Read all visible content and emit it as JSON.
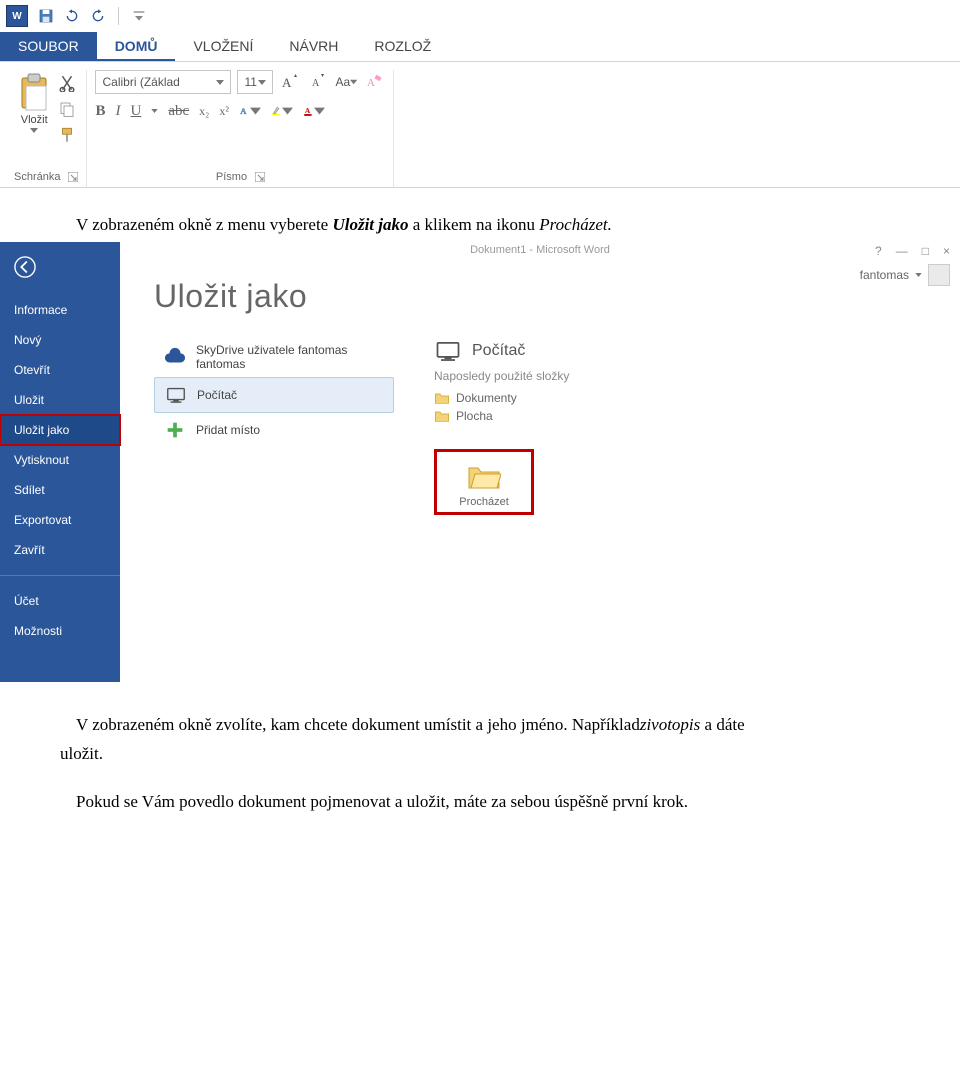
{
  "qat": {
    "app_abbrev": "W"
  },
  "tabs": {
    "file": "SOUBOR",
    "home": "DOMŮ",
    "insert": "VLOŽENÍ",
    "design": "NÁVRH",
    "layout": "ROZLOŽ"
  },
  "ribbon": {
    "clipboard": {
      "paste": "Vložit",
      "group_label": "Schránka"
    },
    "font": {
      "family": "Calibri (Základ",
      "size": "11",
      "group_label": "Písmo",
      "aa": "Aa",
      "bold": "B",
      "italic": "I",
      "underline": "U",
      "strike": "abc",
      "sub": "x₂",
      "sup": "x²"
    }
  },
  "para1": {
    "pre": "V zobrazeném okně z menu vyberete ",
    "em": "Uložit jako",
    "mid": " a klikem na ikonu ",
    "em2": "Procházet.",
    "post": ""
  },
  "backstage": {
    "titlebar": "Dokument1 - Microsoft Word",
    "user": "fantomas",
    "side": {
      "info": "Informace",
      "new": "Nový",
      "open": "Otevřít",
      "save": "Uložit",
      "saveas": "Uložit jako",
      "print": "Vytisknout",
      "share": "Sdílet",
      "export": "Exportovat",
      "close": "Zavřít",
      "account": "Účet",
      "options": "Možnosti"
    },
    "heading": "Uložit jako",
    "locations": {
      "skydrive_l1": "SkyDrive uživatele fantomas",
      "skydrive_l2": "fantomas",
      "computer": "Počítač",
      "add_place": "Přidat místo"
    },
    "right": {
      "computer": "Počítač",
      "recent_heading": "Naposledy použité složky",
      "documents": "Dokumenty",
      "desktop": "Plocha",
      "browse": "Procházet"
    }
  },
  "para2": {
    "pre": "V zobrazeném okně zvolíte, kam chcete dokument umístit a jeho jméno. Například",
    "em": "zivotopis",
    "post": " a dáte"
  },
  "para2b": "uložit.",
  "para3": "Pokud se Vám povedlo dokument pojmenovat a uložit, máte za sebou úspěšně první krok."
}
